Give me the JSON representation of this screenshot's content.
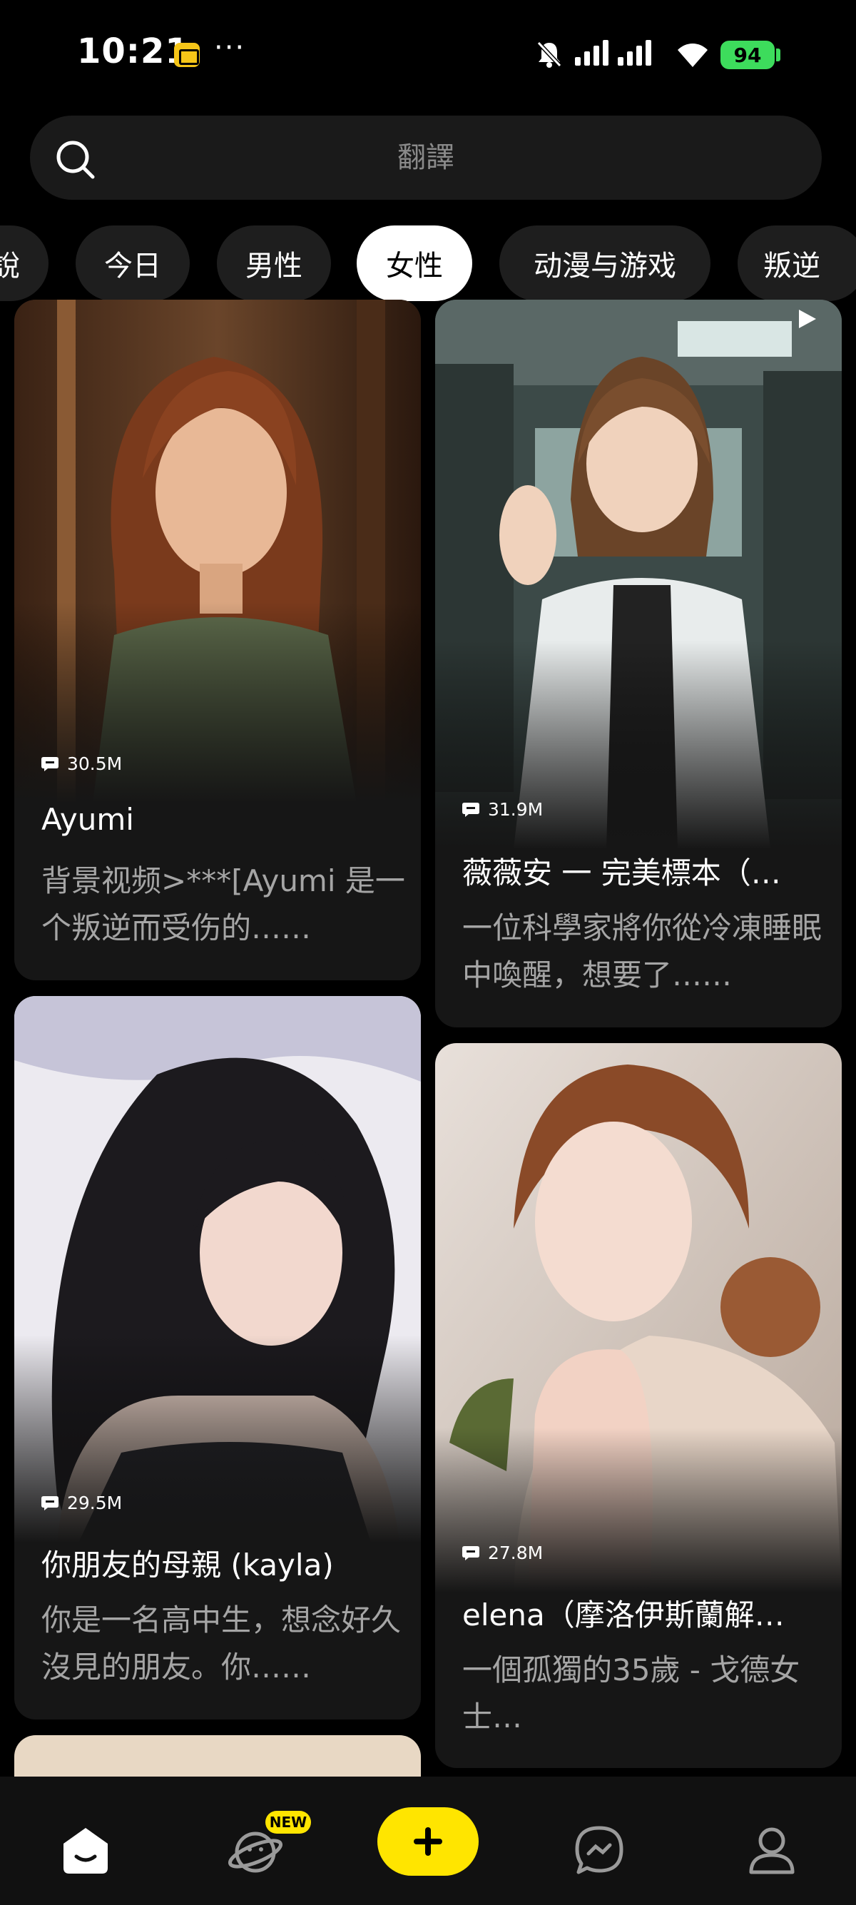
{
  "status_bar": {
    "time": "10:21",
    "more": "···",
    "battery": "94"
  },
  "search": {
    "placeholder": "翻譯"
  },
  "categories": [
    {
      "label": "說"
    },
    {
      "label": "今日"
    },
    {
      "label": "男性"
    },
    {
      "label": "女性",
      "selected": true
    },
    {
      "label": "动漫与游戏"
    },
    {
      "label": "叛逆"
    }
  ],
  "cards": [
    {
      "views": "30.5M",
      "name": "Ayumi",
      "description": "背景视频>***[Ayumi 是一个叛逆而受伤的……"
    },
    {
      "views": "31.9M",
      "name": "薇薇安 一 完美標本（…",
      "description": "一位科學家將你從冷凍睡眠中喚醒，想要了……"
    },
    {
      "views": "29.5M",
      "name": "你朋友的母親 (kayla)",
      "description": "你是一名高中生，想念好久沒見的朋友。你……"
    },
    {
      "views": "27.8M",
      "name": "elena（摩洛伊斯蘭解…",
      "description": "一個孤獨的35歲 - 戈德女士…"
    }
  ],
  "bottom_nav": {
    "new_badge": "NEW"
  },
  "colors": {
    "accent": "#ffe500",
    "background": "#000000",
    "card": "#161616",
    "chip": "#1e1e1e"
  }
}
